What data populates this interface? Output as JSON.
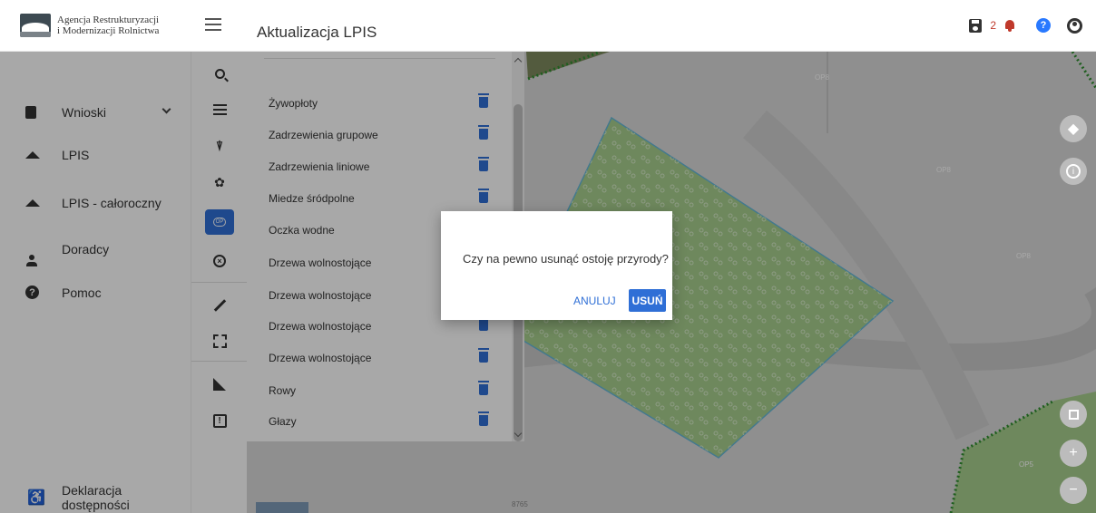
{
  "header": {
    "org_name_line1": "Agencja Restrukturyzacji",
    "org_name_line2": "i Modernizacji Rolnictwa",
    "page_title": "Aktualizacja LPIS",
    "notification_count": "2"
  },
  "sidebar": {
    "items": [
      {
        "label": "Wnioski",
        "icon": "clipboard-icon"
      },
      {
        "label": "LPIS",
        "icon": "mountain-icon"
      },
      {
        "label": "LPIS - całoroczny",
        "icon": "mountain-icon"
      },
      {
        "label": "Doradcy",
        "icon": "person-icon"
      },
      {
        "label": "Pomoc",
        "icon": "help-circle-icon"
      }
    ],
    "footer_label": "Deklaracja dostępności"
  },
  "toolbar": {
    "active_tool_label": "OP"
  },
  "layers": {
    "items": [
      {
        "label": "Żywopłoty"
      },
      {
        "label": "Zadrzewienia grupowe"
      },
      {
        "label": "Zadrzewienia liniowe"
      },
      {
        "label": "Miedze śródpolne"
      },
      {
        "label": "Oczka wodne"
      },
      {
        "label": "Drzewa wolnostojące"
      },
      {
        "label": "Drzewa wolnostojące"
      },
      {
        "label": "Drzewa wolnostojące"
      },
      {
        "label": "Drzewa wolnostojące"
      },
      {
        "label": "Rowy"
      },
      {
        "label": "Głazy"
      }
    ]
  },
  "map": {
    "labels": [
      "OP8",
      "OP8",
      "OP8",
      "OP5",
      "8765"
    ],
    "colors": {
      "polygon_fill": "#a8cf8e",
      "polygon_stroke": "#66b8d8",
      "boundary": "#2f8f2f"
    }
  },
  "dialog": {
    "message": "Czy na pewno usunąć ostoję przyrody?",
    "cancel_label": "ANULUJ",
    "delete_label": "USUŃ"
  }
}
